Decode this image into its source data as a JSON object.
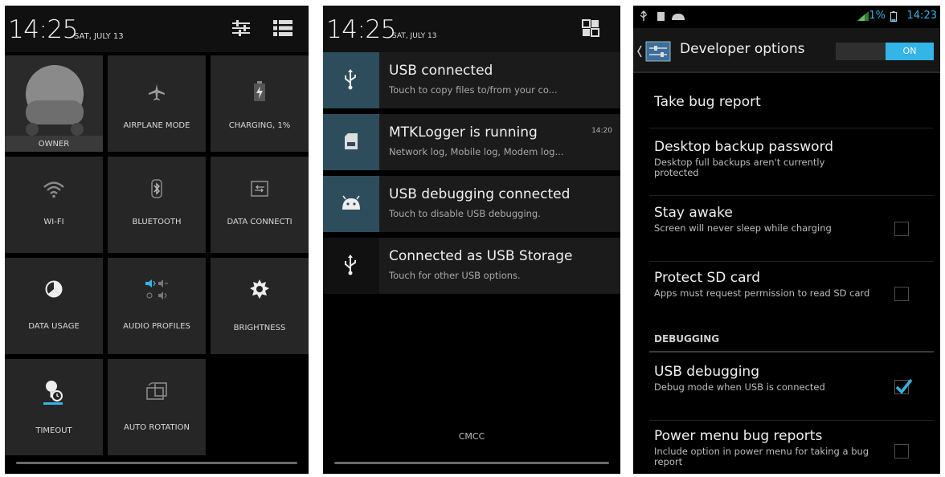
{
  "quick_settings": {
    "time": "14:25",
    "date": "SAT, JULY 13",
    "owner_label": "OWNER",
    "tiles": [
      {
        "label": "AIRPLANE MODE",
        "icon": "airplane-icon"
      },
      {
        "label": "CHARGING, 1%",
        "icon": "battery-charging-icon"
      },
      {
        "label": "WI-FI",
        "icon": "wifi-icon"
      },
      {
        "label": "BLUETOOTH",
        "icon": "bluetooth-icon"
      },
      {
        "label": "DATA CONNECTI",
        "icon": "data-connection-icon"
      },
      {
        "label": "DATA USAGE",
        "icon": "data-usage-icon"
      },
      {
        "label": "AUDIO PROFILES",
        "icon": "audio-profiles-icon"
      },
      {
        "label": "BRIGHTNESS",
        "icon": "brightness-icon"
      },
      {
        "label": "TIMEOUT",
        "icon": "timeout-icon"
      },
      {
        "label": "AUTO ROTATION",
        "icon": "auto-rotation-icon"
      }
    ]
  },
  "notifications": {
    "time": "14:25",
    "date": "SAT, JULY 13",
    "items": [
      {
        "title": "USB connected",
        "text": "Touch to copy files to/from your co...",
        "time": "",
        "icon": "usb-icon"
      },
      {
        "title": "MTKLogger is running",
        "text": "Network log, Mobile log, Modem log...",
        "time": "14:20",
        "icon": "sd-card-icon"
      },
      {
        "title": "USB debugging connected",
        "text": "Touch to disable USB debugging.",
        "time": "",
        "icon": "android-icon"
      },
      {
        "title": "Connected as USB Storage",
        "text": "Touch for other USB options.",
        "time": "",
        "icon": "usb-icon"
      }
    ],
    "carrier": "CMCC"
  },
  "developer_options": {
    "status_bar": {
      "battery": "1%",
      "time": "14:23"
    },
    "title": "Developer options",
    "switch_state": "ON",
    "take_bug_report": "Take bug report",
    "desktop_backup": {
      "title": "Desktop backup password",
      "summary": "Desktop full backups aren't currently protected"
    },
    "stay_awake": {
      "title": "Stay awake",
      "summary": "Screen will never sleep while charging",
      "checked": false
    },
    "protect_sd": {
      "title": "Protect SD card",
      "summary": "Apps must request permission to read SD card",
      "checked": false
    },
    "category_debugging": "DEBUGGING",
    "usb_debugging": {
      "title": "USB debugging",
      "summary": "Debug mode when USB is connected",
      "checked": true
    },
    "power_menu": {
      "title": "Power menu bug reports",
      "summary": "Include option in power menu for taking a bug report",
      "checked": false
    }
  },
  "colors": {
    "accent": "#33b5e5",
    "tile": "#262626",
    "notif_icon_bg": "#2e4d5c"
  }
}
